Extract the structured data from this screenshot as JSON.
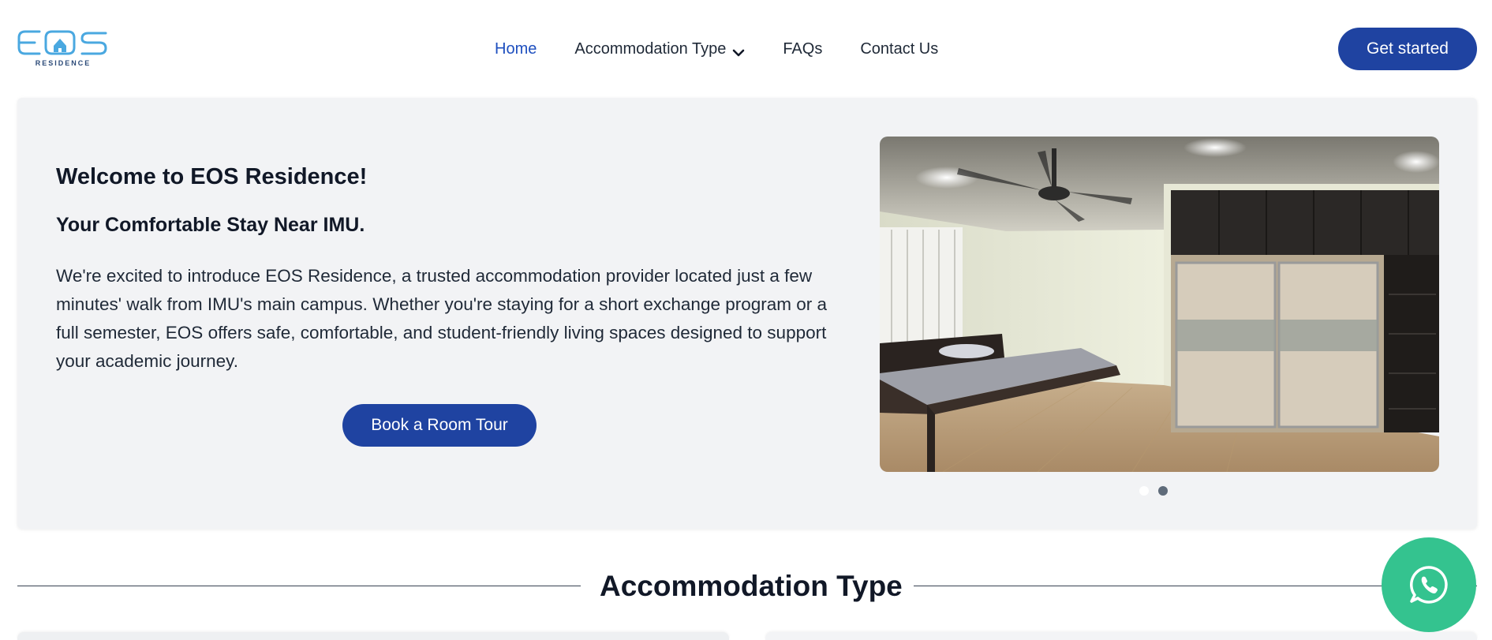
{
  "brand": {
    "logo_tagline": "RESIDENCE",
    "logo_letters": "EOS"
  },
  "nav": {
    "items": [
      {
        "label": "Home",
        "active": true
      },
      {
        "label": "Accommodation Type",
        "has_dropdown": true
      },
      {
        "label": "FAQs"
      },
      {
        "label": "Contact Us"
      }
    ],
    "cta_label": "Get started"
  },
  "hero": {
    "title": "Welcome to EOS Residence!",
    "subtitle": "Your Comfortable Stay Near IMU.",
    "description": "We're excited to introduce EOS Residence, a trusted accommodation provider located just a few minutes' walk from IMU's main campus. Whether you're staying for a short exchange program or a full semester, EOS offers safe, comfortable, and student-friendly living spaces designed to support your academic journey.",
    "button_label": "Book a Room Tour",
    "carousel": {
      "slide_count": 2,
      "active_index": 1
    }
  },
  "section": {
    "title": "Accommodation Type"
  },
  "colors": {
    "primary": "#1f43a1",
    "nav_active": "#1e4fbf",
    "hero_bg": "#f2f3f5",
    "whatsapp": "#34c38f",
    "logo": "#4aa8e0"
  },
  "icons": {
    "dropdown": "chevron-down-icon",
    "floating": "whatsapp-icon"
  }
}
